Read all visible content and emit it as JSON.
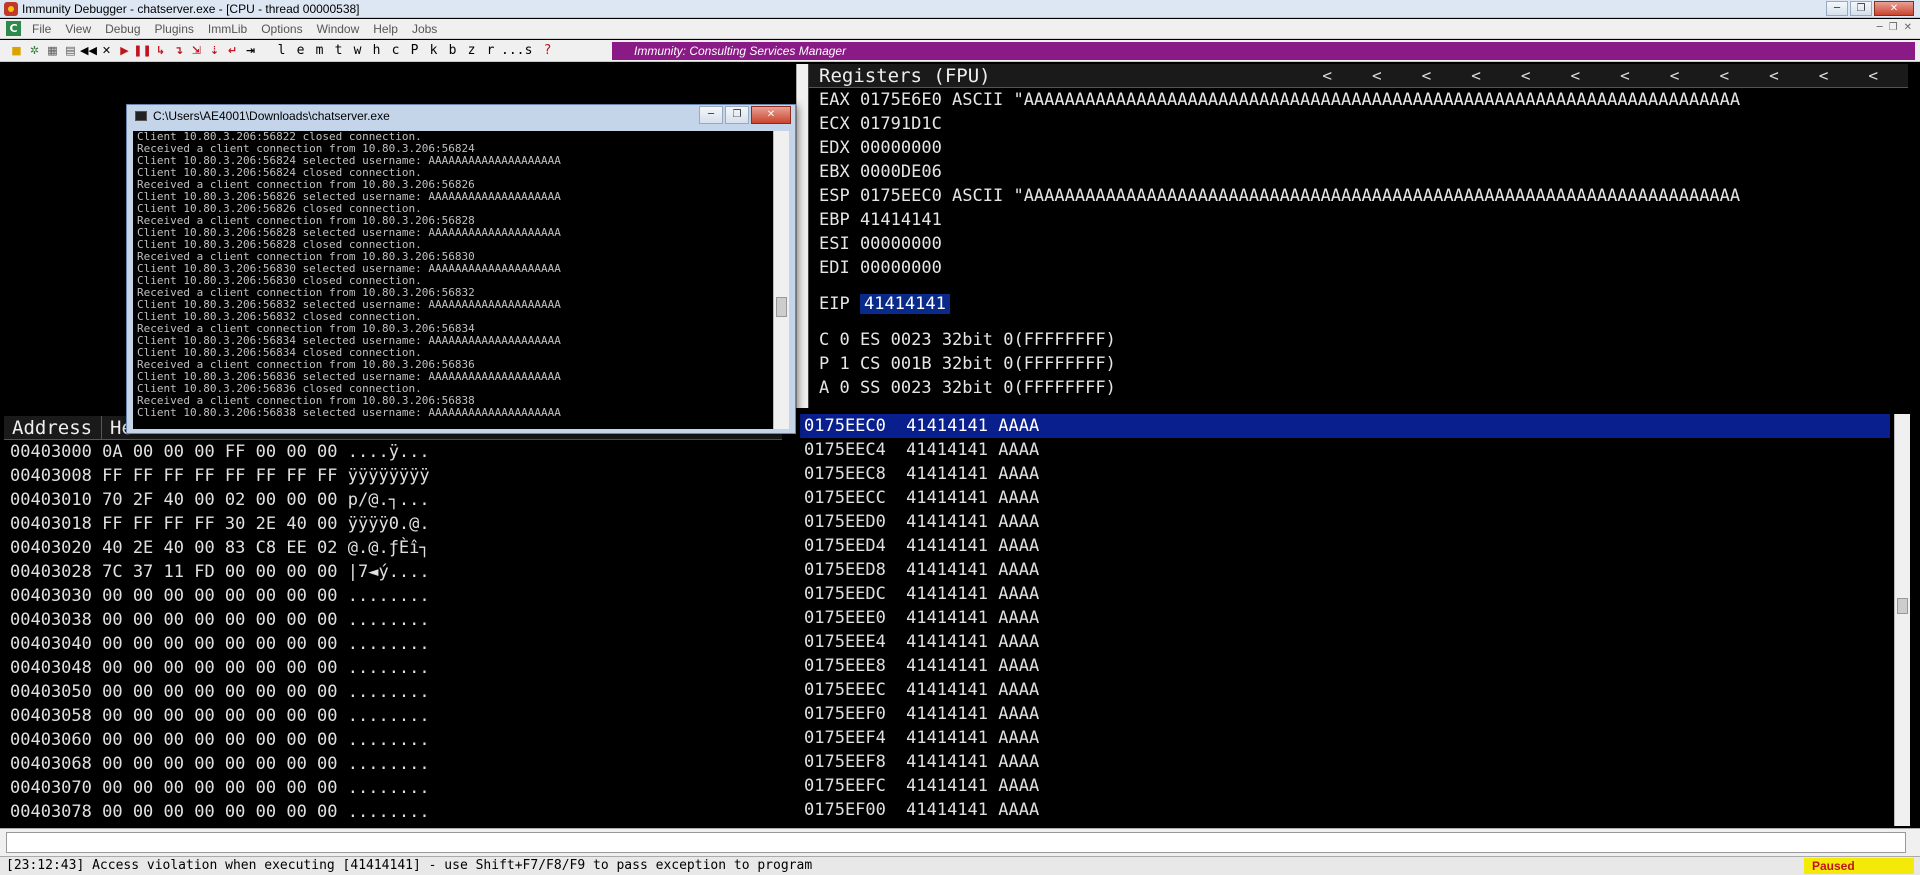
{
  "window": {
    "title": "Immunity Debugger - chatserver.exe - [CPU - thread 00000538]",
    "controls": [
      "─",
      "❐",
      "✕"
    ]
  },
  "menu": {
    "items": [
      "File",
      "View",
      "Debug",
      "Plugins",
      "ImmLib",
      "Options",
      "Window",
      "Help",
      "Jobs"
    ]
  },
  "toolbar": {
    "letters": [
      "l",
      "e",
      "m",
      "t",
      "w",
      "h",
      "c",
      "P",
      "k",
      "b",
      "z",
      "r",
      "...",
      "s",
      "?"
    ],
    "banner": "Immunity: Consulting Services Manager"
  },
  "registers": {
    "header": "Registers (FPU)",
    "arrows": [
      "<",
      "<",
      "<",
      "<",
      "<",
      "<",
      "<",
      "<",
      "<",
      "<",
      "<",
      "<"
    ],
    "lines": [
      "EAX 0175E6E0 ASCII \"AAAAAAAAAAAAAAAAAAAAAAAAAAAAAAAAAAAAAAAAAAAAAAAAAAAAAAAAAAAAAAAAAAAAAA",
      "ECX 01791D1C",
      "EDX 00000000",
      "EBX 0000DE06",
      "ESP 0175EEC0 ASCII \"AAAAAAAAAAAAAAAAAAAAAAAAAAAAAAAAAAAAAAAAAAAAAAAAAAAAAAAAAAAAAAAAAAAAAA",
      "EBP 41414141",
      "ESI 00000000",
      "EDI 00000000"
    ],
    "eip_label": "EIP",
    "eip_value": "41414141",
    "flags": [
      "C 0  ES 0023 32bit 0(FFFFFFFF)",
      "P 1  CS 001B 32bit 0(FFFFFFFF)",
      "A 0  SS 0023 32bit 0(FFFFFFFF)"
    ]
  },
  "dump": {
    "headers": [
      "Address",
      "He"
    ],
    "rows": [
      "00403000 0A 00 00 00 FF 00 00 00 ....ÿ...",
      "00403008 FF FF FF FF FF FF FF FF ÿÿÿÿÿÿÿÿ",
      "00403010 70 2F 40 00 02 00 00 00 p/@.┐...",
      "00403018 FF FF FF FF 30 2E 40 00 ÿÿÿÿ0.@.",
      "00403020 40 2E 40 00 83 C8 EE 02 @.@.ƒÈî┐",
      "00403028 7C 37 11 FD 00 00 00 00 |7◄ý....",
      "00403030 00 00 00 00 00 00 00 00 ........",
      "00403038 00 00 00 00 00 00 00 00 ........",
      "00403040 00 00 00 00 00 00 00 00 ........",
      "00403048 00 00 00 00 00 00 00 00 ........",
      "00403050 00 00 00 00 00 00 00 00 ........",
      "00403058 00 00 00 00 00 00 00 00 ........",
      "00403060 00 00 00 00 00 00 00 00 ........",
      "00403068 00 00 00 00 00 00 00 00 ........",
      "00403070 00 00 00 00 00 00 00 00 ........",
      "00403078 00 00 00 00 00 00 00 00 ........"
    ]
  },
  "stack": {
    "rows": [
      {
        "addr": "0175EEC0",
        "val": "41414141",
        "ascii": "AAAA"
      },
      {
        "addr": "0175EEC4",
        "val": "41414141",
        "ascii": "AAAA"
      },
      {
        "addr": "0175EEC8",
        "val": "41414141",
        "ascii": "AAAA"
      },
      {
        "addr": "0175EECC",
        "val": "41414141",
        "ascii": "AAAA"
      },
      {
        "addr": "0175EED0",
        "val": "41414141",
        "ascii": "AAAA"
      },
      {
        "addr": "0175EED4",
        "val": "41414141",
        "ascii": "AAAA"
      },
      {
        "addr": "0175EED8",
        "val": "41414141",
        "ascii": "AAAA"
      },
      {
        "addr": "0175EEDC",
        "val": "41414141",
        "ascii": "AAAA"
      },
      {
        "addr": "0175EEE0",
        "val": "41414141",
        "ascii": "AAAA"
      },
      {
        "addr": "0175EEE4",
        "val": "41414141",
        "ascii": "AAAA"
      },
      {
        "addr": "0175EEE8",
        "val": "41414141",
        "ascii": "AAAA"
      },
      {
        "addr": "0175EEEC",
        "val": "41414141",
        "ascii": "AAAA"
      },
      {
        "addr": "0175EEF0",
        "val": "41414141",
        "ascii": "AAAA"
      },
      {
        "addr": "0175EEF4",
        "val": "41414141",
        "ascii": "AAAA"
      },
      {
        "addr": "0175EEF8",
        "val": "41414141",
        "ascii": "AAAA"
      },
      {
        "addr": "0175EEFC",
        "val": "41414141",
        "ascii": "AAAA"
      },
      {
        "addr": "0175EF00",
        "val": "41414141",
        "ascii": "AAAA"
      }
    ]
  },
  "console": {
    "title": "C:\\Users\\AE4001\\Downloads\\chatserver.exe",
    "lines": [
      "Client 10.80.3.206:56822 closed connection.",
      "Received a client connection from 10.80.3.206:56824",
      "Client 10.80.3.206:56824 selected username: AAAAAAAAAAAAAAAAAAAA",
      "Client 10.80.3.206:56824 closed connection.",
      "Received a client connection from 10.80.3.206:56826",
      "Client 10.80.3.206:56826 selected username: AAAAAAAAAAAAAAAAAAAA",
      "Client 10.80.3.206:56826 closed connection.",
      "Received a client connection from 10.80.3.206:56828",
      "Client 10.80.3.206:56828 selected username: AAAAAAAAAAAAAAAAAAAA",
      "Client 10.80.3.206:56828 closed connection.",
      "Received a client connection from 10.80.3.206:56830",
      "Client 10.80.3.206:56830 selected username: AAAAAAAAAAAAAAAAAAAA",
      "Client 10.80.3.206:56830 closed connection.",
      "Received a client connection from 10.80.3.206:56832",
      "Client 10.80.3.206:56832 selected username: AAAAAAAAAAAAAAAAAAAA",
      "Client 10.80.3.206:56832 closed connection.",
      "Received a client connection from 10.80.3.206:56834",
      "Client 10.80.3.206:56834 selected username: AAAAAAAAAAAAAAAAAAAA",
      "Client 10.80.3.206:56834 closed connection.",
      "Received a client connection from 10.80.3.206:56836",
      "Client 10.80.3.206:56836 selected username: AAAAAAAAAAAAAAAAAAAA",
      "Client 10.80.3.206:56836 closed connection.",
      "Received a client connection from 10.80.3.206:56838",
      "Client 10.80.3.206:56838 selected username: AAAAAAAAAAAAAAAAAAAA",
      "_"
    ]
  },
  "status": {
    "message": "[23:12:43] Access violation when executing [41414141] - use Shift+F7/F8/F9 to pass exception to program",
    "state": "Paused"
  },
  "colors": {
    "banner": "#8a1a85",
    "selection": "#0a1f8e",
    "paused_bg": "#f5e90a",
    "paused_fg": "#c0141f"
  }
}
